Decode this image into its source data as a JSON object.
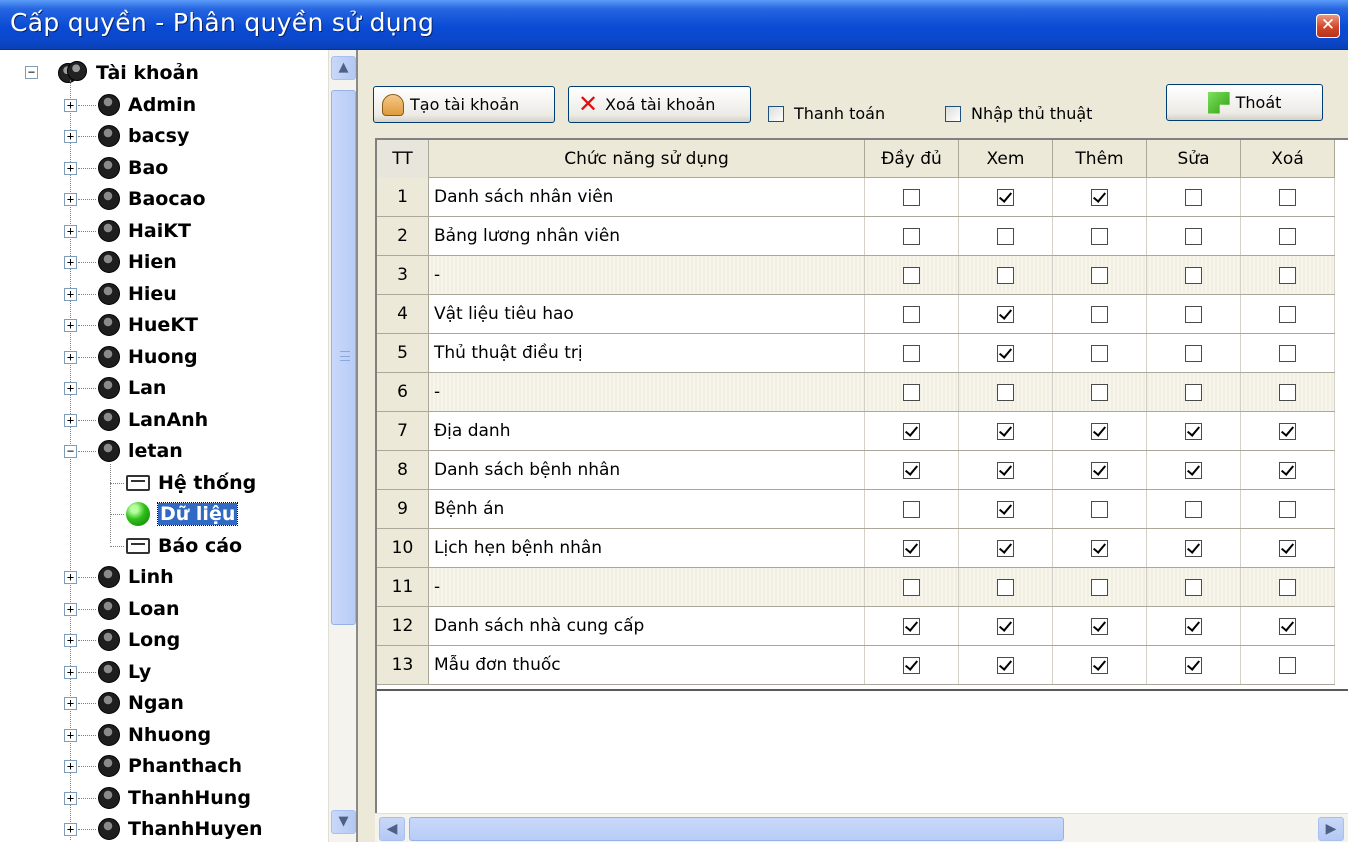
{
  "window": {
    "title": "Cấp quyền - Phân quyền sử dụng",
    "close_glyph": "✕"
  },
  "tree": {
    "root_label": "Tài khoản",
    "users": [
      "Admin",
      "bacsy",
      "Bao",
      "Baocao",
      "HaiKT",
      "Hien",
      "Hieu",
      "HueKT",
      "Huong",
      "Lan",
      "LanAnh",
      "letan",
      "Linh",
      "Loan",
      "Long",
      "Ly",
      "Ngan",
      "Nhuong",
      "Phanthach",
      "ThanhHung",
      "ThanhHuyen"
    ],
    "expanded_user": "letan",
    "children": [
      "Hệ thống",
      "Dữ liệu",
      "Báo cáo"
    ],
    "selected_child": "Dữ liệu"
  },
  "toolbar": {
    "create_label": "Tạo tài khoản",
    "delete_label": "Xoá tài khoản",
    "payment_label": "Thanh toán",
    "payment_checked": false,
    "procedure_label": "Nhập thủ thuật",
    "procedure_checked": false,
    "exit_label": "Thoát"
  },
  "grid": {
    "columns": [
      "TT",
      "Chức năng sử dụng",
      "Đầy đủ",
      "Xem",
      "Thêm",
      "Sửa",
      "Xoá"
    ],
    "rows": [
      {
        "tt": "1",
        "name": "Danh sách nhân viên",
        "perms": [
          false,
          true,
          true,
          false,
          false
        ]
      },
      {
        "tt": "2",
        "name": "Bảng lương nhân viên",
        "perms": [
          false,
          false,
          false,
          false,
          false
        ]
      },
      {
        "tt": "3",
        "name": "-",
        "perms": [
          false,
          false,
          false,
          false,
          false
        ],
        "alt": true
      },
      {
        "tt": "4",
        "name": "Vật liệu tiêu hao",
        "perms": [
          false,
          true,
          false,
          false,
          false
        ]
      },
      {
        "tt": "5",
        "name": "Thủ thuật điều trị",
        "perms": [
          false,
          true,
          false,
          false,
          false
        ]
      },
      {
        "tt": "6",
        "name": "-",
        "perms": [
          false,
          false,
          false,
          false,
          false
        ],
        "alt": true
      },
      {
        "tt": "7",
        "name": "Địa danh",
        "perms": [
          true,
          true,
          true,
          true,
          true
        ]
      },
      {
        "tt": "8",
        "name": "Danh sách bệnh nhân",
        "perms": [
          true,
          true,
          true,
          true,
          true
        ]
      },
      {
        "tt": "9",
        "name": "Bệnh án",
        "perms": [
          false,
          true,
          false,
          false,
          false
        ]
      },
      {
        "tt": "10",
        "name": "Lịch hẹn bệnh nhân",
        "perms": [
          true,
          true,
          true,
          true,
          true
        ]
      },
      {
        "tt": "11",
        "name": "-",
        "perms": [
          false,
          false,
          false,
          false,
          false
        ],
        "alt": true
      },
      {
        "tt": "12",
        "name": "Danh sách nhà cung cấp",
        "perms": [
          true,
          true,
          true,
          true,
          true
        ]
      },
      {
        "tt": "13",
        "name": "Mẫu đơn thuốc",
        "perms": [
          true,
          true,
          true,
          true,
          false
        ]
      }
    ]
  },
  "colors": {
    "title_bar": "#0A4BD6",
    "selection": "#316AC5",
    "panel_bg": "#ECE9D8"
  }
}
